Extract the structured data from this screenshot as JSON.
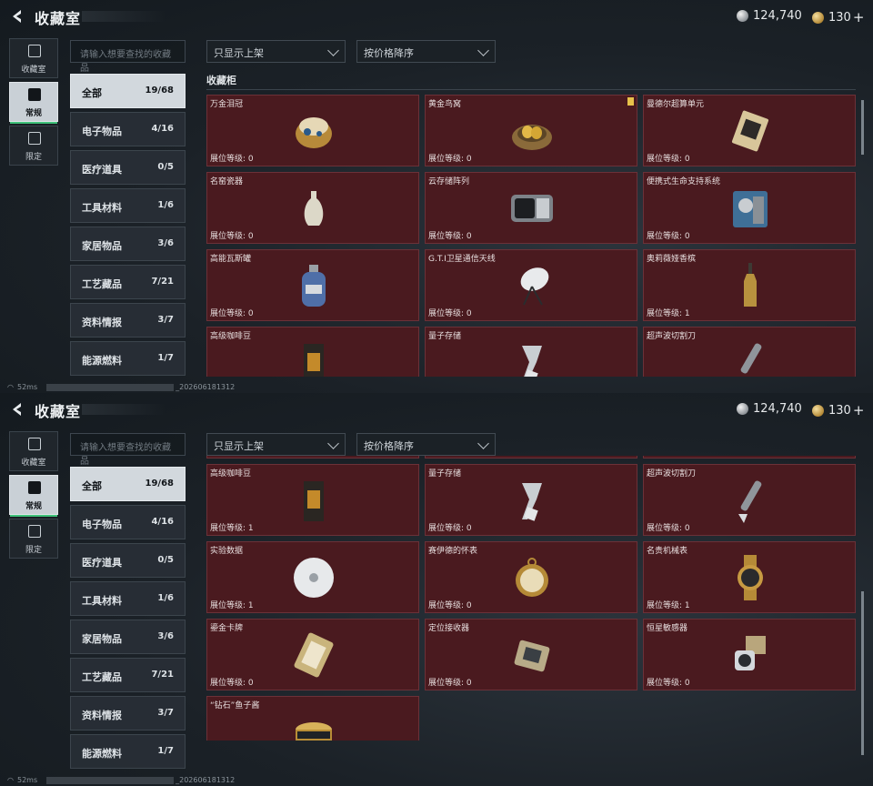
{
  "colors": {
    "card_bg": "#4a1a1f",
    "active_tab_accent": "#3fc27a"
  },
  "header": {
    "title": "收藏室",
    "silver": "124,740",
    "gold": "130",
    "gold_plus": "+"
  },
  "sidebar": {
    "items": [
      {
        "label": "收藏室",
        "icon": "collection-icon"
      },
      {
        "label": "常规",
        "icon": "regular-icon"
      },
      {
        "label": "限定",
        "icon": "limited-icon"
      }
    ]
  },
  "search": {
    "placeholder": "请输入想要查找的收藏品"
  },
  "filters": {
    "display": "只显示上架",
    "sort": "按价格降序"
  },
  "categories": [
    {
      "name": "全部",
      "count": "19/68"
    },
    {
      "name": "电子物品",
      "count": "4/16"
    },
    {
      "name": "医疗道具",
      "count": "0/5"
    },
    {
      "name": "工具材料",
      "count": "1/6"
    },
    {
      "name": "家居物品",
      "count": "3/6"
    },
    {
      "name": "工艺藏品",
      "count": "7/21"
    },
    {
      "name": "资料情报",
      "count": "3/7"
    },
    {
      "name": "能源燃料",
      "count": "1/7"
    }
  ],
  "section_title": "收藏柜",
  "level_label": "展位等级:",
  "items": [
    {
      "name": "万金泪冠",
      "level": "0",
      "icon": "jeweled-egg-icon"
    },
    {
      "name": "黄金鸟窝",
      "level": "0",
      "icon": "golden-nest-icon"
    },
    {
      "name": "曼德尔超算单元",
      "level": "0",
      "icon": "supercomputer-unit-icon"
    },
    {
      "name": "名窑瓷器",
      "level": "0",
      "icon": "porcelain-vase-icon"
    },
    {
      "name": "云存储阵列",
      "level": "0",
      "icon": "storage-array-icon"
    },
    {
      "name": "便携式生命支持系统",
      "level": "0",
      "icon": "life-support-icon"
    },
    {
      "name": "高能瓦斯罐",
      "level": "0",
      "icon": "gas-canister-icon"
    },
    {
      "name": "G.T.I卫星通信天线",
      "level": "0",
      "icon": "satellite-dish-icon"
    },
    {
      "name": "奥莉薇娅香槟",
      "level": "1",
      "icon": "champagne-icon"
    },
    {
      "name": "高级咖啡豆",
      "level": "1",
      "icon": "coffee-bag-icon"
    },
    {
      "name": "量子存储",
      "level": "0",
      "icon": "quantum-storage-icon"
    },
    {
      "name": "超声波切割刀",
      "level": "0",
      "icon": "ultrasonic-knife-icon"
    },
    {
      "name": "实验数据",
      "level": "1",
      "icon": "data-disc-icon"
    },
    {
      "name": "赛伊德的怀表",
      "level": "0",
      "icon": "pocket-watch-icon"
    },
    {
      "name": "名贵机械表",
      "level": "1",
      "icon": "wristwatch-icon"
    },
    {
      "name": "鎏金卡牌",
      "level": "0",
      "icon": "gilded-card-icon"
    },
    {
      "name": "定位接收器",
      "level": "0",
      "icon": "locator-receiver-icon"
    },
    {
      "name": "恒星敏感器",
      "level": "0",
      "icon": "star-sensor-icon"
    },
    {
      "name": "“钻石”鱼子酱",
      "level": "",
      "icon": "caviar-tin-icon"
    }
  ],
  "status": {
    "ping": "52ms",
    "build": "_202606181312"
  }
}
